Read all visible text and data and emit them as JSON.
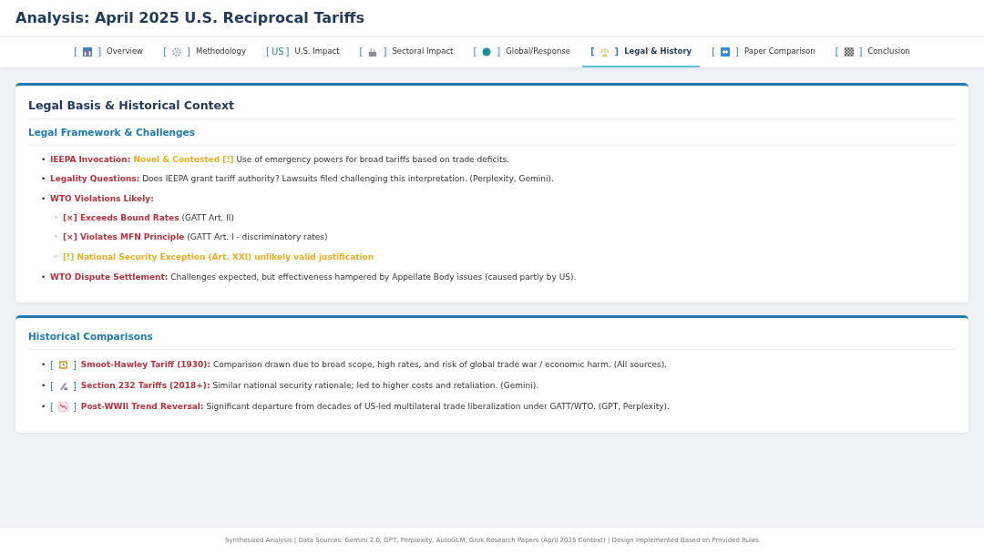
{
  "header": {
    "title": "Analysis: April 2025 U.S. Reciprocal Tariffs"
  },
  "tabs": [
    {
      "kind": "chart",
      "open": "[",
      "close": "]",
      "label": "Overview",
      "selected": false
    },
    {
      "kind": "gear",
      "open": "[",
      "close": "]",
      "label": "Methodology",
      "selected": false
    },
    {
      "kind": "text",
      "open": "[",
      "icon_text": "US",
      "close": "]",
      "label": "U.S. Impact",
      "selected": false
    },
    {
      "kind": "factory",
      "open": "[",
      "close": "]",
      "label": "Sectoral Impact",
      "selected": false
    },
    {
      "kind": "globe",
      "open": "[",
      "close": "]",
      "label": "Global/Response",
      "selected": false
    },
    {
      "kind": "scales",
      "open": "[",
      "close": "]",
      "label": "Legal & History",
      "selected": true
    },
    {
      "kind": "arrows",
      "open": "[",
      "close": "]",
      "label": "Paper Comparison",
      "selected": false
    },
    {
      "kind": "flag",
      "open": "[",
      "close": "]",
      "label": "Conclusion",
      "selected": false
    }
  ],
  "legal_card": {
    "title": "Legal Basis & Historical Context",
    "heading": "Legal Framework & Challenges",
    "items": [
      {
        "marker": "•",
        "segments": [
          {
            "color": "#b8323c",
            "text": "IEEPA Invocation: "
          },
          {
            "color": "#e8b020",
            "text": "Novel & Contested [!]"
          },
          {
            "text": " Use of emergency powers for broad tariffs based on trade deficits."
          }
        ]
      },
      {
        "marker": "•",
        "segments": [
          {
            "color": "#b8323c",
            "text": "Legality Questions:"
          },
          {
            "text": " Does IEEPA grant tariff authority? Lawsuits filed challenging this interpretation. (Perplexity, Gemini)."
          }
        ]
      },
      {
        "marker": "•",
        "segments": [
          {
            "color": "#b8323c",
            "text": "WTO Violations Likely:"
          }
        ],
        "children": [
          {
            "marker": "◦",
            "segments": [
              {
                "color": "#b8323c",
                "text": "[×] Exceeds Bound Rates"
              },
              {
                "text": " (GATT Art. II)"
              }
            ]
          },
          {
            "marker": "◦",
            "segments": [
              {
                "color": "#b8323c",
                "text": "[×] Violates MFN Principle"
              },
              {
                "text": " (GATT Art. I - discriminatory rates)"
              }
            ]
          },
          {
            "marker": "◦",
            "segments": [
              {
                "color": "#e8b020",
                "text": "[!] National Security Exception (Art. XXI) unlikely valid justification"
              }
            ]
          }
        ]
      },
      {
        "marker": "•",
        "segments": [
          {
            "color": "#b8323c",
            "text": "WTO Dispute Settlement:"
          },
          {
            "text": " Challenges expected, but effectiveness hampered by Appellate Body issues (caused partly by US)."
          }
        ]
      }
    ]
  },
  "history_card": {
    "heading": "Historical Comparisons",
    "items": [
      {
        "marker": "•",
        "open": "[",
        "close": "]",
        "kind": "clock",
        "segments": [
          {
            "color": "#b8323c",
            "text": "Smoot-Hawley Tariff (1930):"
          },
          {
            "text": " Comparison drawn due to broad scope, high rates, and risk of global trade war / economic harm. (All sources)."
          }
        ]
      },
      {
        "marker": "•",
        "open": "[",
        "close": "]",
        "kind": "steel",
        "segments": [
          {
            "color": "#b8323c",
            "text": "Section 232 Tariffs (2018+):"
          },
          {
            "text": " Similar national security rationale; led to higher costs and retaliation. (Gemini)."
          }
        ]
      },
      {
        "marker": "•",
        "open": "[",
        "close": "]",
        "kind": "trend",
        "segments": [
          {
            "color": "#b8323c",
            "text": "Post-WWII Trend Reversal:"
          },
          {
            "text": " Significant departure from decades of US-led multilateral trade liberalization under GATT/WTO. (GPT, Perplexity)."
          }
        ]
      }
    ]
  },
  "footer": "Synthesized Analysis | Data Sources: Gemini 2.0, GPT, Perplexity, AutoGLM, Grok Research Papers (April 2025 Context) | Design Implemented Based on Provided Rules"
}
